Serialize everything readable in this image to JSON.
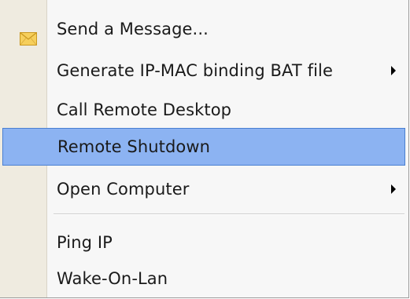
{
  "menu": {
    "items": [
      {
        "label": "Send a Message...",
        "icon": "envelope-icon",
        "has_submenu": false,
        "highlighted": false
      },
      {
        "label": "Generate IP-MAC binding BAT file",
        "has_submenu": true,
        "highlighted": false
      },
      {
        "label": "Call Remote Desktop",
        "has_submenu": false,
        "highlighted": false
      },
      {
        "label": "Remote Shutdown",
        "has_submenu": false,
        "highlighted": true
      },
      {
        "label": "Open Computer",
        "has_submenu": true,
        "highlighted": false
      },
      {
        "label": "Ping IP",
        "has_submenu": false,
        "highlighted": false
      },
      {
        "label": "Wake-On-Lan",
        "has_submenu": false,
        "highlighted": false
      }
    ]
  },
  "colors": {
    "highlight_fill": "#8cb3f2",
    "highlight_border": "#4a7fd1",
    "gutter": "#efebe0",
    "envelope": "#f0c040"
  }
}
